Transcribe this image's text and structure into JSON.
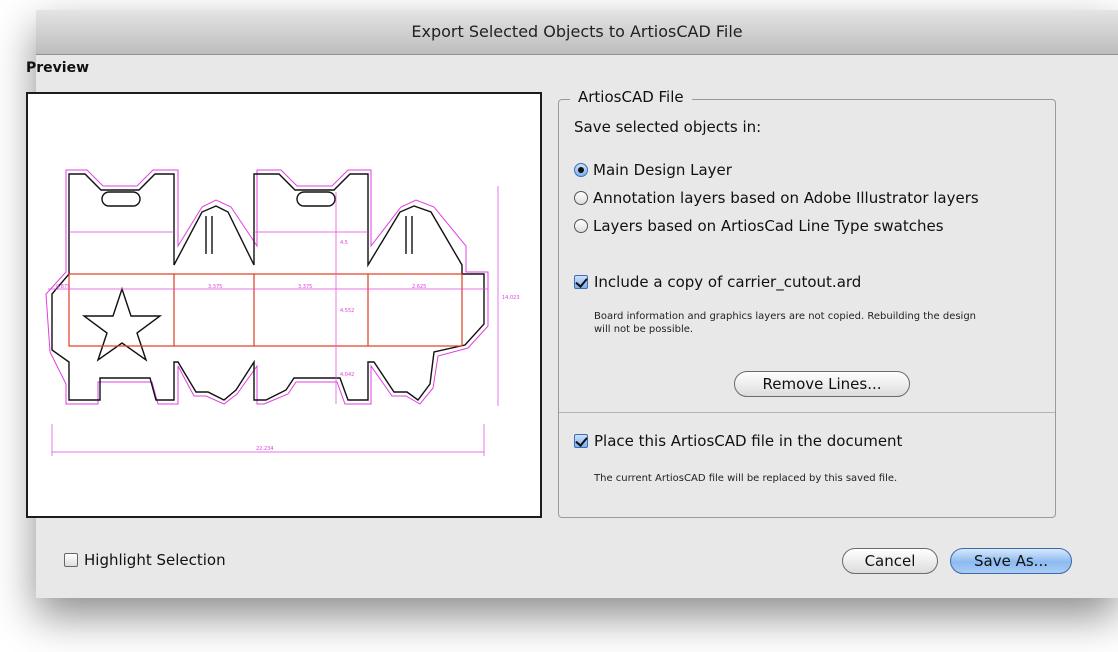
{
  "window": {
    "title": "Export Selected Objects to ArtiosCAD File"
  },
  "preview": {
    "label": "Preview",
    "dimension_labels": {
      "top_left": "0.875",
      "panel_a": "3.375",
      "panel_b": "3.375",
      "panel_c": "2.625",
      "vertical_top": "4.5",
      "vertical_mid": "4.552",
      "vertical_bottom": "4.042",
      "overall_height": "14.023",
      "overall_width": "22.234"
    }
  },
  "artioscad_group": {
    "legend": "ArtiosCAD File",
    "save_in_label": "Save selected objects in:",
    "options": [
      {
        "label": "Main Design Layer",
        "selected": true
      },
      {
        "label": "Annotation layers based on Adobe Illustrator layers",
        "selected": false
      },
      {
        "label": "Layers based on ArtiosCad Line Type swatches",
        "selected": false
      }
    ],
    "include_copy": {
      "label": "Include a copy of carrier_cutout.ard",
      "checked": true,
      "note_line1": "Board information and graphics layers are not copied.  Rebuilding the design",
      "note_line2": "will not be possible."
    },
    "remove_lines_button": "Remove Lines...",
    "place_file": {
      "label": "Place this ArtiosCAD file in the document",
      "checked": true,
      "note": "The current ArtiosCAD file will be replaced by this saved file."
    }
  },
  "footer": {
    "highlight_selection": {
      "label": "Highlight Selection",
      "checked": false
    },
    "cancel_button": "Cancel",
    "save_as_button": "Save As..."
  },
  "colors": {
    "cut_line": "#111111",
    "crease_line": "#e23a1f",
    "dimension_line": "#e040e0",
    "default_button": "#8cbaf0"
  }
}
